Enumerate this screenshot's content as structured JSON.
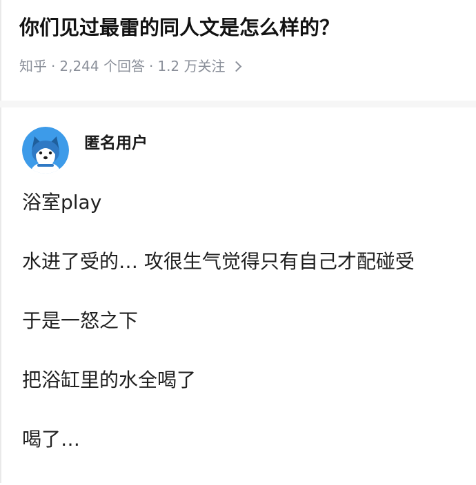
{
  "question": {
    "title": "你们见过最雷的同人文是怎么样的？",
    "meta": {
      "source": "知乎",
      "dot": "·",
      "answers": "2,244 个回答",
      "followers": "1.2 万关注"
    }
  },
  "answer": {
    "author": {
      "name": "匿名用户",
      "avatar_icon": "anonymous-dog-avatar"
    },
    "paragraphs": [
      "浴室play",
      "水进了受的… 攻很生气觉得只有自己才配碰受",
      "于是一怒之下",
      "把浴缸里的水全喝了",
      "喝了…"
    ]
  },
  "colors": {
    "title": "#121212",
    "meta": "#8a8f99",
    "body_text": "#1f1f1f",
    "avatar_blue": "#3d9be9",
    "divider": "#f6f6f6"
  }
}
